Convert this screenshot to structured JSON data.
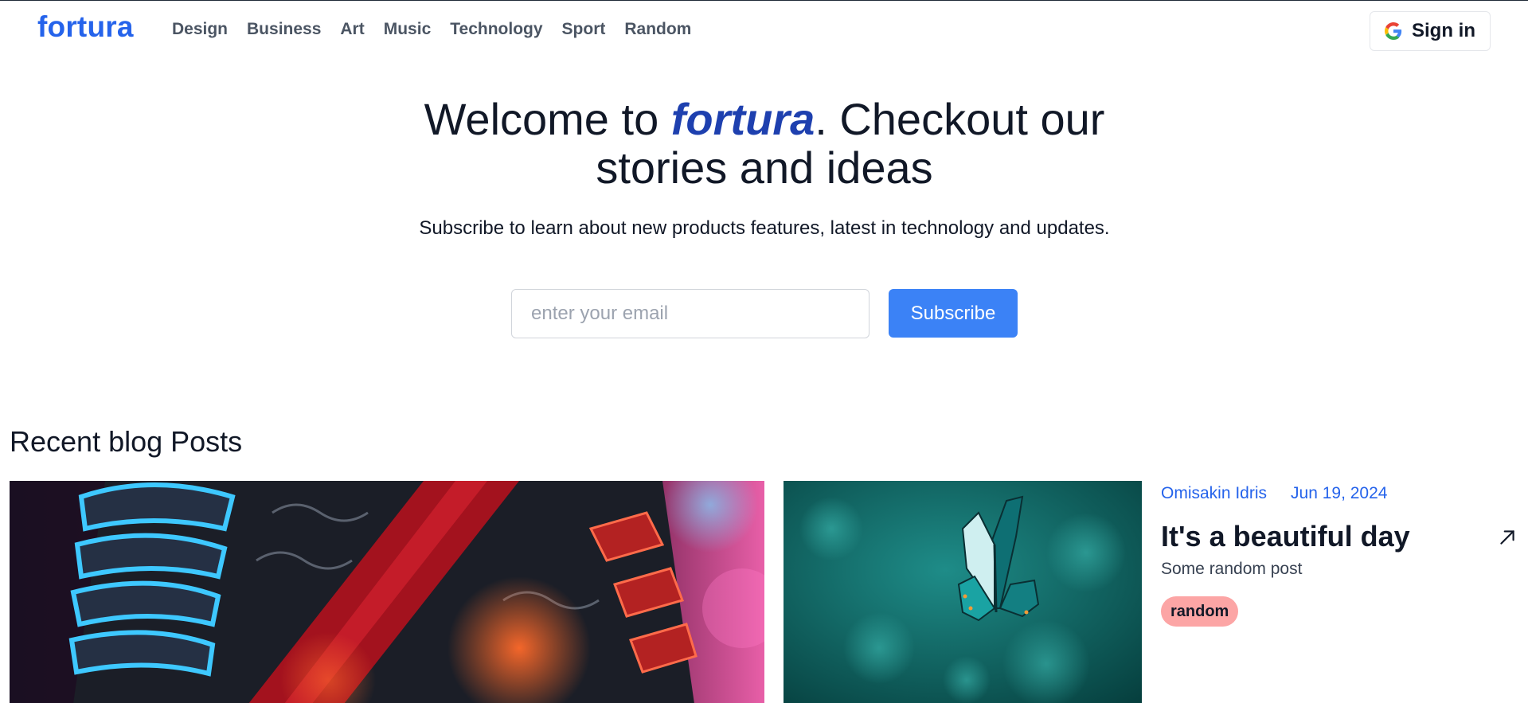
{
  "nav": {
    "logo": "fortura",
    "links": [
      "Design",
      "Business",
      "Art",
      "Music",
      "Technology",
      "Sport",
      "Random"
    ],
    "signin_label": "Sign in"
  },
  "hero": {
    "title_prefix": "Welcome to ",
    "title_brand": "fortura",
    "title_suffix": ". Checkout our stories and ideas",
    "subtitle": "Subscribe to learn about new products features, latest in technology and updates.",
    "email_placeholder": "enter your email",
    "subscribe_label": "Subscribe"
  },
  "recent": {
    "title": "Recent blog Posts",
    "featured_post": {
      "author": "Omisakin Idris",
      "date": "Jun 19, 2024",
      "title": "It's a beautiful day",
      "description": "Some random post",
      "tag": "random",
      "tag_color": "#fca5a5"
    }
  },
  "colors": {
    "brand": "#2563eb",
    "brand_dark": "#1e40af",
    "button": "#3b82f6"
  },
  "icons": {
    "signin": "google-icon",
    "post_link": "arrow-up-right-icon"
  }
}
